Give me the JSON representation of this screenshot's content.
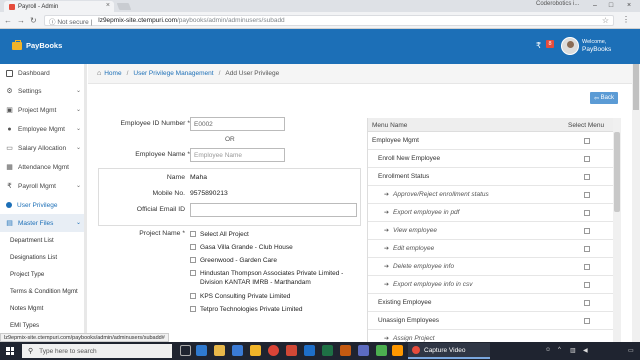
{
  "browser": {
    "tab_title": "Payroll - Admin",
    "profile_name": "Coderobotics i...",
    "security_label": "Not secure",
    "url_host": "lz9epmix-site.ctempuri.com",
    "url_path": "/paybooks/admin/adminusers/subadd",
    "status_url": "lz9epmix-site.ctempuri.com/paybooks/admin/adminusers/subadd#"
  },
  "header": {
    "brand": "PayBooks",
    "currency_symbol": "₹",
    "notification_count": "8",
    "welcome_label": "Welcome,",
    "user_name": "PayBooks"
  },
  "sidebar": {
    "items": [
      {
        "label": "Dashboard"
      },
      {
        "label": "Settings"
      },
      {
        "label": "Project Mgmt"
      },
      {
        "label": "Employee Mgmt"
      },
      {
        "label": "Salary Allocation"
      },
      {
        "label": "Attendance Mgmt"
      },
      {
        "label": "Payroll Mgmt"
      },
      {
        "label": "User Privilege"
      },
      {
        "label": "Master Files"
      }
    ],
    "sub_items": [
      {
        "label": "Department List"
      },
      {
        "label": "Designations List"
      },
      {
        "label": "Project Type"
      },
      {
        "label": "Terms & Condition Mgmt"
      },
      {
        "label": "Notes Mgmt"
      },
      {
        "label": "EMI Types"
      }
    ]
  },
  "breadcrumb": {
    "home": "Home",
    "parent": "User Privilege Management",
    "current": "Add User Privilege"
  },
  "back_label": "Back",
  "form": {
    "emp_id_label": "Employee ID Number",
    "emp_id_value": "E0002",
    "or_label": "OR",
    "emp_name_label": "Employee Name",
    "emp_name_placeholder": "Employee Name",
    "name_label": "Name",
    "name_value": "Maha",
    "mobile_label": "Mobile No.",
    "mobile_value": "9575890213",
    "email_label": "Official Email ID",
    "email_value": "",
    "project_label": "Project Name",
    "select_all_label": "Select All Project",
    "projects": [
      "Gasa Villa Grande - Club House",
      "Greenwood - Garden Care",
      "Hindustan Thompson Associates Private Limited - Division KANTAR IMRB - Marthandam",
      "KPS Consulting Private Limited",
      "Tetpro Technologies Private Limited"
    ]
  },
  "menu_table": {
    "col_menu": "Menu Name",
    "col_select": "Select Menu",
    "rows": [
      {
        "label": "Employee Mgmt"
      },
      {
        "label": "Enroll New Employee"
      },
      {
        "label": "Enrollment Status"
      },
      {
        "label": "Approve/Reject enrollment status"
      },
      {
        "label": "Export employee in pdf"
      },
      {
        "label": "View employee"
      },
      {
        "label": "Edit employee"
      },
      {
        "label": "Delete employee info"
      },
      {
        "label": "Export employee info in csv"
      },
      {
        "label": "Existing Employee"
      },
      {
        "label": "Unassign Employees"
      },
      {
        "label": "Assign Project"
      }
    ]
  },
  "taskbar": {
    "search_placeholder": "Type here to search",
    "capture_label": "Capture Video"
  }
}
